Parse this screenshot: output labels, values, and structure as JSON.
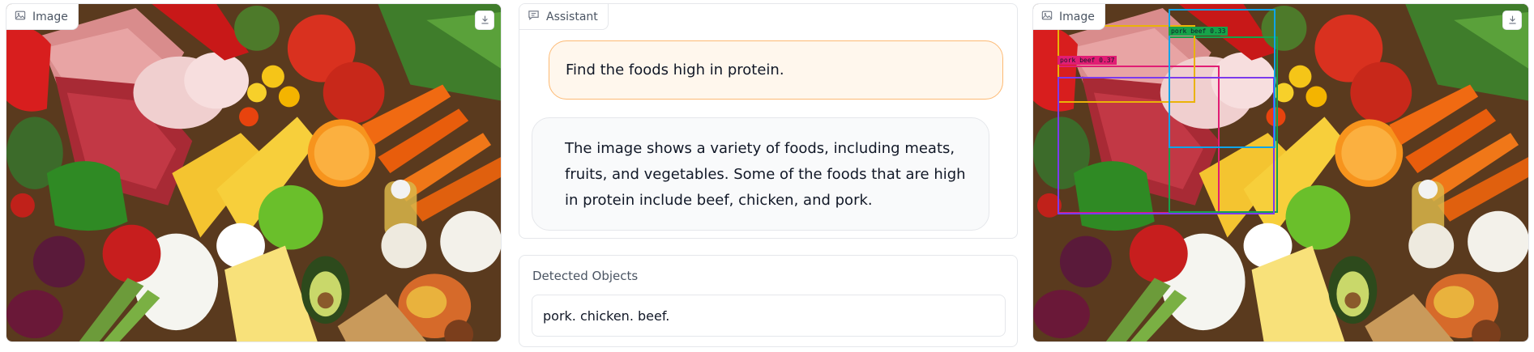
{
  "input_image": {
    "label": "Image",
    "icon": "image-icon",
    "download_icon": "download-icon"
  },
  "chat": {
    "label": "Assistant",
    "icon": "chat-icon",
    "user_message": "Find the foods high in protein.",
    "assistant_message": "The image shows a variety of foods, including meats, fruits, and vegetables. Some of the foods that are high in protein include beef, chicken, and pork."
  },
  "detected_objects": {
    "label": "Detected Objects",
    "value": "pork. chicken. beef."
  },
  "output_image": {
    "label": "Image",
    "icon": "image-icon",
    "download_icon": "download-icon",
    "detections": [
      {
        "label": "pork beef 0.37",
        "color": "#e11d74"
      },
      {
        "label": "pork beef 0.33",
        "color": "#16a34a"
      },
      {
        "label": "",
        "color": "#eab308"
      },
      {
        "label": "",
        "color": "#7c3aed"
      },
      {
        "label": "",
        "color": "#0ea5e9"
      }
    ]
  },
  "colors": {
    "user_bubble_bg": "#fff7ed",
    "user_bubble_border": "#fdba74",
    "bot_bubble_bg": "#f9fafb",
    "panel_border": "#e5e7eb"
  }
}
